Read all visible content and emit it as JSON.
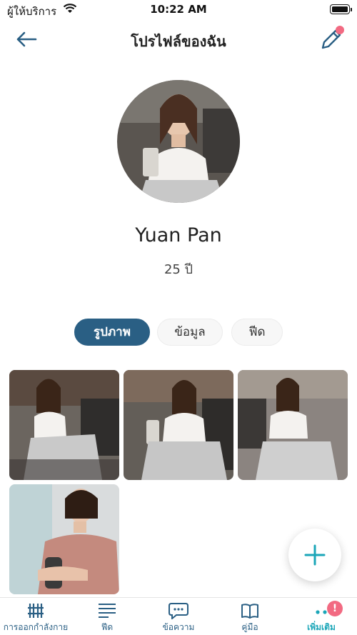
{
  "status_bar": {
    "carrier": "ผู้ให้บริการ",
    "time": "10:22 AM"
  },
  "header": {
    "title": "โปรไฟล์ของฉัน",
    "back_icon": "arrow-left-icon",
    "edit_icon": "pencil-icon"
  },
  "profile": {
    "name": "Yuan Pan",
    "age": "25 ปี"
  },
  "tabs": [
    {
      "label": "รูปภาพ",
      "active": true
    },
    {
      "label": "ข้อมูล",
      "active": false
    },
    {
      "label": "ฟีด",
      "active": false
    }
  ],
  "photos_count_shown": 4,
  "fab": {
    "icon": "plus-icon"
  },
  "bottom_nav": {
    "items": [
      {
        "label": "การออกกำลังกาย",
        "icon": "dumbbell-icon"
      },
      {
        "label": "ฟีด",
        "icon": "feed-lines-icon"
      },
      {
        "label": "ข้อความ",
        "icon": "chat-bubble-icon"
      },
      {
        "label": "คู่มือ",
        "icon": "book-icon"
      },
      {
        "label": "เพิ่มเติม",
        "icon": "more-dots-icon",
        "active": true,
        "badge": "!"
      }
    ]
  },
  "colors": {
    "primary": "#2a5f84",
    "accent": "#1ba6b8",
    "badge": "#f26a82"
  }
}
